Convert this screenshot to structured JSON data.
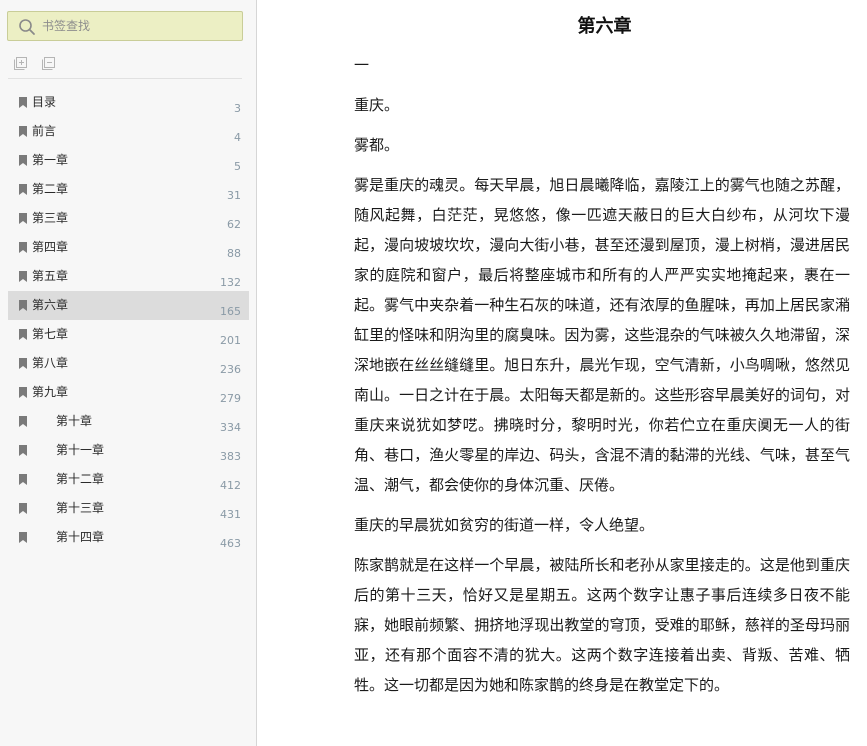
{
  "sidebar": {
    "search": {
      "placeholder": "书签查找",
      "value": ""
    },
    "tools": [
      {
        "icon": "expand-all-icon"
      },
      {
        "icon": "collapse-all-icon"
      }
    ],
    "toc": [
      {
        "label": "目录",
        "page": "3"
      },
      {
        "label": "前言",
        "page": "4"
      },
      {
        "label": "第一章",
        "page": "5"
      },
      {
        "label": "第二章",
        "page": "31"
      },
      {
        "label": "第三章",
        "page": "62"
      },
      {
        "label": "第四章",
        "page": "88"
      },
      {
        "label": "第五章",
        "page": "132"
      },
      {
        "label": "第六章",
        "page": "165"
      },
      {
        "label": "第七章",
        "page": "201"
      },
      {
        "label": "第八章",
        "page": "236"
      },
      {
        "label": "第九章",
        "page": "279"
      },
      {
        "label": "第十章",
        "page": "334"
      },
      {
        "label": "第十一章",
        "page": "383"
      },
      {
        "label": "第十二章",
        "page": "412"
      },
      {
        "label": "第十三章",
        "page": "431"
      },
      {
        "label": "第十四章",
        "page": "463"
      }
    ],
    "active_item": "第六章"
  },
  "reader": {
    "chapter_title": "第六章",
    "paragraphs": [
      "一",
      "重庆。",
      "雾都。",
      "雾是重庆的魂灵。每天早晨，旭日晨曦降临，嘉陵江上的雾气也随之苏醒，随风起舞，白茫茫，晃悠悠，像一匹遮天蔽日的巨大白纱布，从河坎下漫起，漫向坡坡坎坎，漫向大街小巷，甚至还漫到屋顶，漫上树梢，漫进居民家的庭院和窗户，最后将整座城市和所有的人严严实实地掩起来，裹在一起。雾气中夹杂着一种生石灰的味道，还有浓厚的鱼腥味，再加上居民家潲缸里的怪味和阴沟里的腐臭味。因为雾，这些混杂的气味被久久地滞留，深深地嵌在丝丝缝缝里。旭日东升，晨光乍现，空气清新，小鸟啁啾，悠然见南山。一日之计在于晨。太阳每天都是新的。这些形容早晨美好的词句，对重庆来说犹如梦呓。拂晓时分，黎明时光，你若伫立在重庆阒无一人的街角、巷口，渔火零星的岸边、码头，含混不清的黏滞的光线、气味，甚至气温、潮气，都会使你的身体沉重、厌倦。",
      "重庆的早晨犹如贫穷的街道一样，令人绝望。",
      "陈家鹊就是在这样一个早晨，被陆所长和老孙从家里接走的。这是他到重庆后的第十三天，恰好又是星期五。这两个数字让惠子事后连续多日夜不能寐，她眼前频繁、拥挤地浮现出教堂的穹顶，受难的耶稣，慈祥的圣母玛丽亚，还有那个面容不清的犹大。这两个数字连接着出卖、背叛、苦难、牺牲。这一切都是因为她和陈家鹊的终身是在教堂定下的。"
    ]
  }
}
